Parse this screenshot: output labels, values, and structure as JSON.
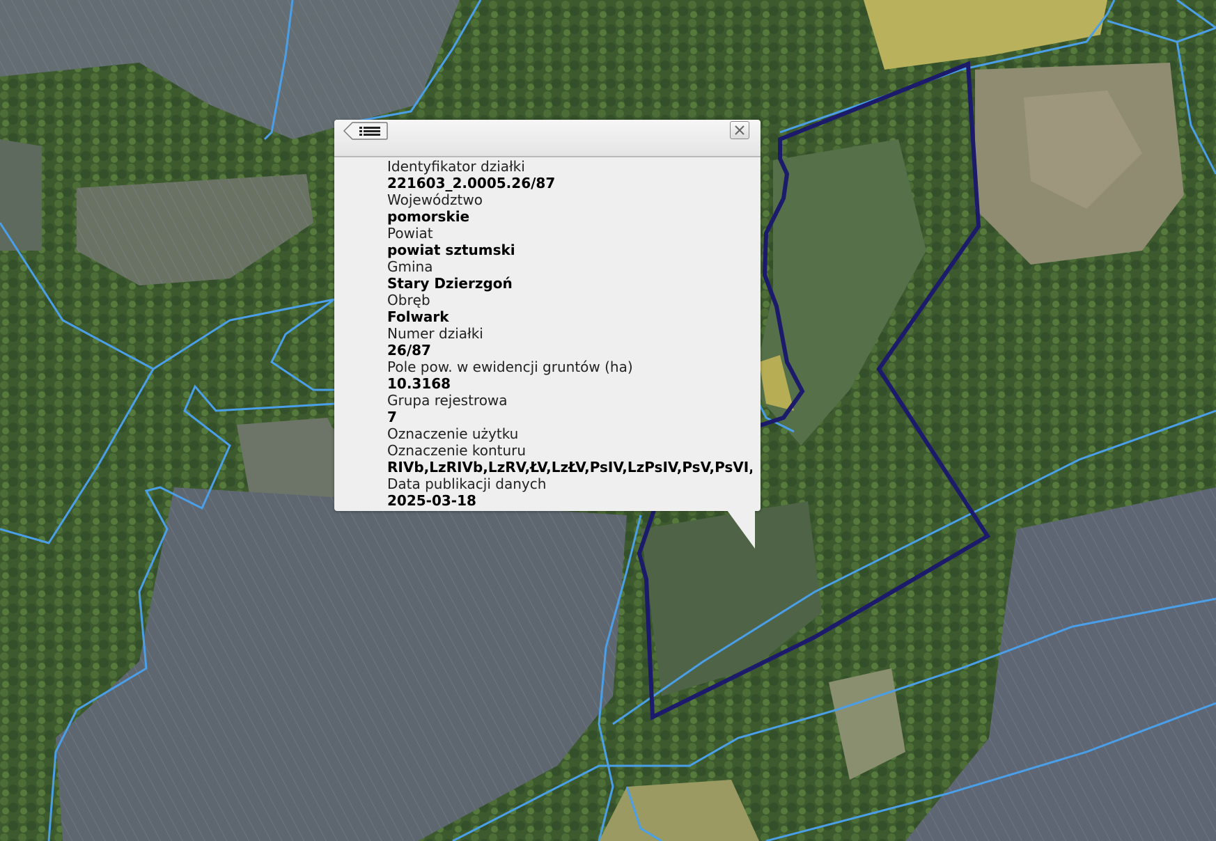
{
  "map": {
    "selected_parcel_color": "#1c1a6b",
    "parcel_boundary_color": "#4a9fe8"
  },
  "popup": {
    "back_icon": "list-back-icon",
    "close_icon": "close-icon",
    "fields": [
      {
        "label": "Identyfikator działki",
        "value": "221603_2.0005.26/87"
      },
      {
        "label": "Województwo",
        "value": "pomorskie"
      },
      {
        "label": "Powiat",
        "value": "powiat sztumski"
      },
      {
        "label": "Gmina",
        "value": "Stary Dzierzgoń"
      },
      {
        "label": "Obręb",
        "value": "Folwark"
      },
      {
        "label": "Numer działki",
        "value": "26/87"
      },
      {
        "label": "Pole pow. w ewidencji gruntów (ha)",
        "value": "10.3168"
      },
      {
        "label": "Grupa rejestrowa",
        "value": "7"
      },
      {
        "label": "Oznaczenie użytku",
        "value": ""
      },
      {
        "label": "Oznaczenie konturu",
        "value": "RIVb,LzRIVb,LzRV,ŁV,LzŁV,PsIV,LzPsIV,PsV,PsVI,LzPsV"
      },
      {
        "label": "Data publikacji danych",
        "value": "2025-03-18"
      }
    ]
  }
}
